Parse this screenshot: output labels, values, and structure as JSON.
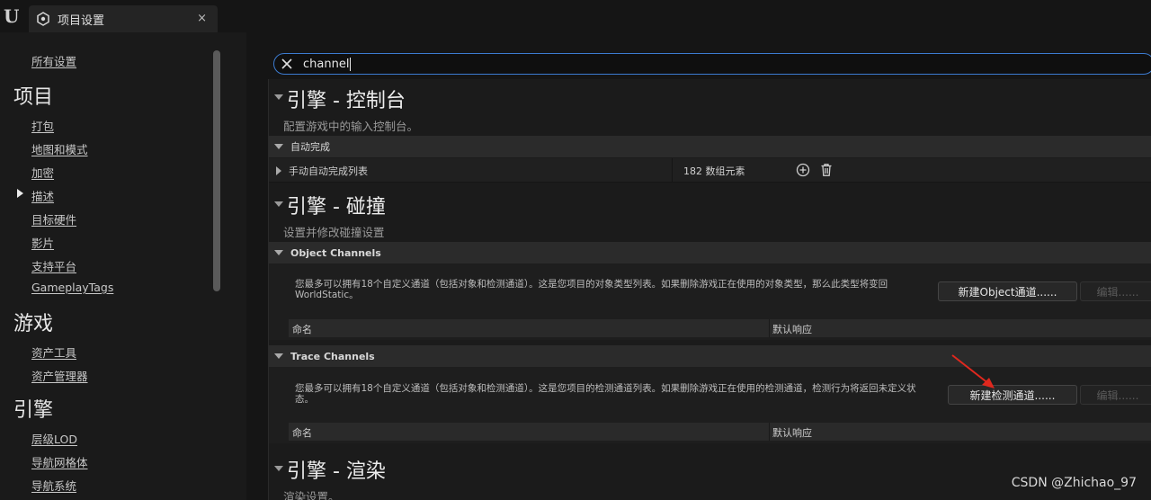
{
  "window": {
    "tab_title": "项目设置",
    "tab_close": "×"
  },
  "sidebar": {
    "all_settings": "所有设置",
    "categories": [
      {
        "title": "项目",
        "items": [
          "打包",
          "地图和模式",
          "加密",
          "描述",
          "目标硬件",
          "影片",
          "支持平台",
          "GameplayTags"
        ]
      },
      {
        "title": "游戏",
        "items": [
          "资产工具",
          "资产管理器"
        ]
      },
      {
        "title": "引擎",
        "items": [
          "层级LOD",
          "导航网格体",
          "导航系统"
        ]
      }
    ],
    "selected_item": "描述"
  },
  "search": {
    "query": "channel"
  },
  "sections": {
    "console": {
      "title": "引擎 - 控制台",
      "description": "配置游戏中的输入控制台。",
      "subsection": "自动完成",
      "row": {
        "name": "手动自动完成列表",
        "value": "182 数组元素"
      }
    },
    "collision": {
      "title": "引擎 - 碰撞",
      "description": "设置并修改碰撞设置",
      "object_channels": {
        "header": "Object Channels",
        "info": "您最多可以拥有18个自定义通道（包括对象和检测通道）。这是您项目的对象类型列表。如果删除游戏正在使用的对象类型，那么此类型将变回WorldStatic。",
        "new_button": "新建Object通道......",
        "edit_button": "编辑......",
        "col_name": "命名",
        "col_response": "默认响应"
      },
      "trace_channels": {
        "header": "Trace Channels",
        "info": "您最多可以拥有18个自定义通道（包括对象和检测通道）。这是您项目的检测通道列表。如果删除游戏正在使用的检测通道，检测行为将返回未定义状态。",
        "new_button": "新建检测通道......",
        "edit_button": "编辑......",
        "col_name": "命名",
        "col_response": "默认响应"
      }
    },
    "rendering": {
      "title": "引擎 - 渲染",
      "description": "渲染设置。"
    }
  },
  "watermark": "CSDN @Zhichao_97",
  "colors": {
    "accent_blue": "#3c7bd0",
    "annotation_red": "#e0281e",
    "background": "#151515",
    "panel": "#1b1b1b"
  }
}
